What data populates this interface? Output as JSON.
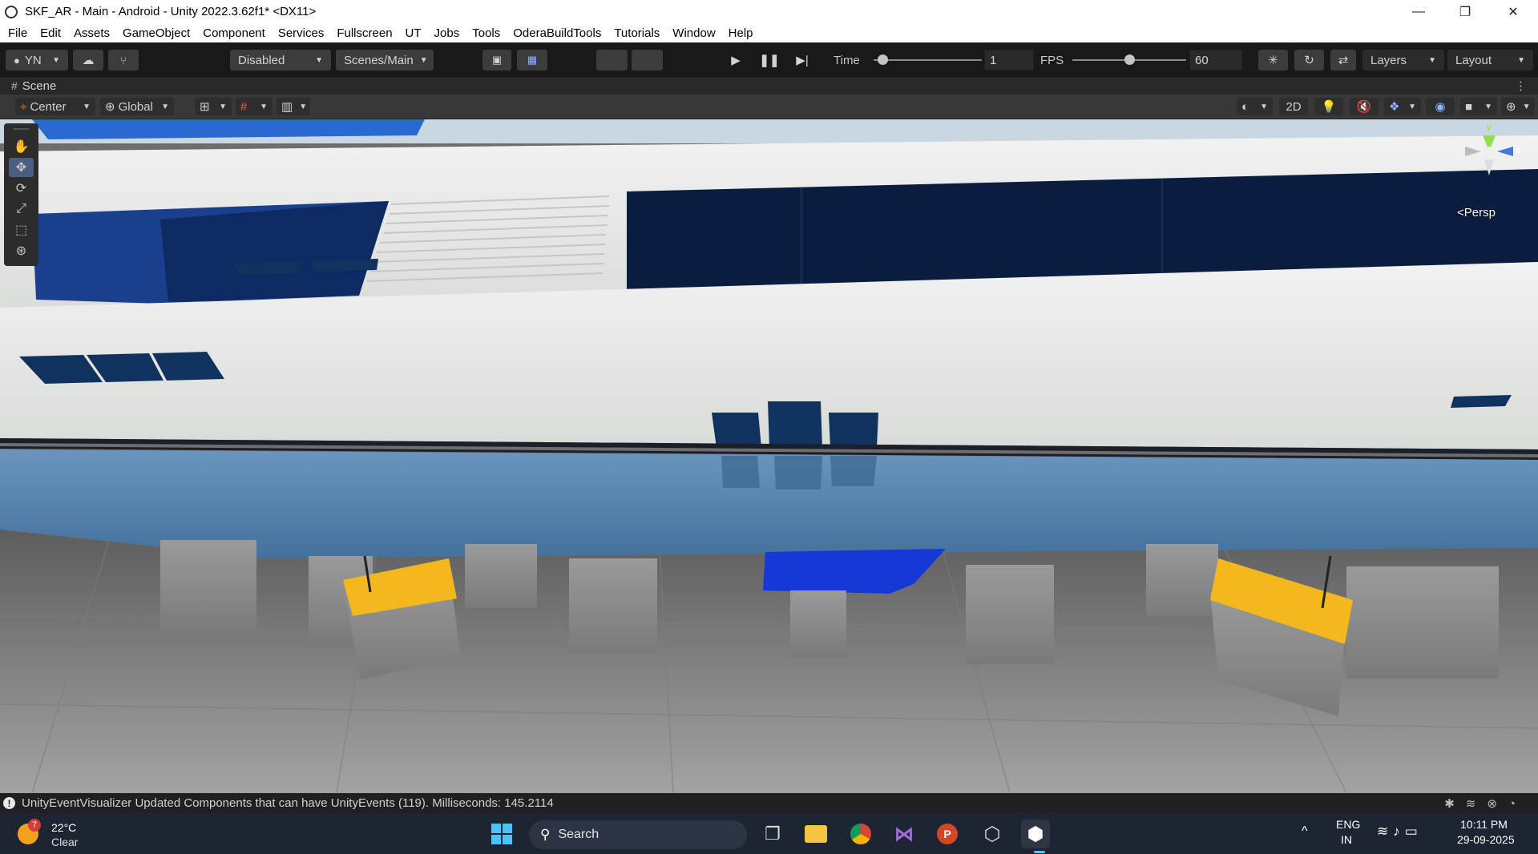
{
  "window": {
    "title": "SKF_AR - Main - Android - Unity 2022.3.62f1* <DX11>",
    "controls": [
      "—",
      "❐",
      "✕"
    ]
  },
  "menu": [
    "File",
    "Edit",
    "Assets",
    "GameObject",
    "Component",
    "Services",
    "Fullscreen",
    "UT",
    "Jobs",
    "Tools",
    "OderaBuildTools",
    "Tutorials",
    "Window",
    "Help"
  ],
  "toolbar": {
    "account": "YN",
    "platform_dropdown": "Disabled",
    "scene_dropdown": "Scenes/Main",
    "time_label": "Time",
    "time_value": "1",
    "time_fraction": 0.08,
    "fps_label": "FPS",
    "fps_value": "60",
    "fps_fraction": 0.5,
    "layers": "Layers",
    "layout": "Layout"
  },
  "scene_tab": {
    "label": "Scene"
  },
  "scene_options": {
    "pivot": "Center",
    "space": "Global",
    "mode_2d": "2D"
  },
  "gizmo": {
    "y_axis": "y",
    "z_axis": "z",
    "projection": "<Persp"
  },
  "status": {
    "message": "UnityEventVisualizer Updated Components that can have UnityEvents (119). Milliseconds: 145.2114"
  },
  "taskbar": {
    "weather_badge": "7",
    "temperature": "22°C",
    "condition": "Clear",
    "search_placeholder": "Search",
    "language_line1": "ENG",
    "language_line2": "IN",
    "time": "10:11 PM",
    "date": "29-09-2025"
  },
  "colors": {
    "hull_white": "#e4e6e4",
    "hull_blue": "#5a85ad",
    "window_navy": "#0b1d3e",
    "keel_blue": "#1538d6",
    "support_yellow": "#f2b81d",
    "concrete": "#8f8f8f"
  }
}
